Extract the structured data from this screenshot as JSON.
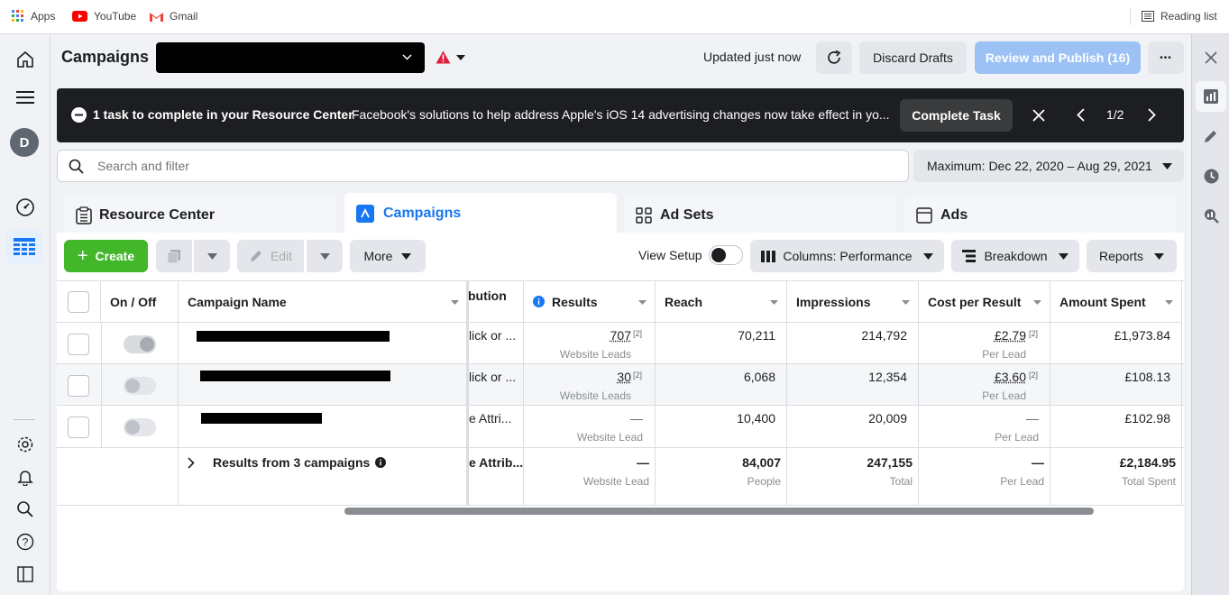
{
  "bookmarks": {
    "apps": "Apps",
    "youtube": "YouTube",
    "gmail": "Gmail",
    "reading_list": "Reading list"
  },
  "header": {
    "title": "Campaigns",
    "updated": "Updated just now",
    "discard": "Discard Drafts",
    "publish": "Review and Publish (16)",
    "more_dots": "•••"
  },
  "banner": {
    "task": "1 task to complete in your Resource Center",
    "message": "Facebook's solutions to help address Apple's iOS 14 advertising changes now take effect in yo...",
    "button": "Complete Task",
    "pager": "1/2"
  },
  "search": {
    "placeholder": "Search and filter"
  },
  "daterange": {
    "label": "Maximum: Dec 22, 2020 – Aug 29, 2021"
  },
  "tabs": [
    {
      "label": "Resource Center"
    },
    {
      "label": "Campaigns"
    },
    {
      "label": "Ad Sets"
    },
    {
      "label": "Ads"
    }
  ],
  "toolbar": {
    "create": "Create",
    "edit": "Edit",
    "more": "More",
    "view_setup": "View Setup",
    "columns": "Columns: Performance",
    "breakdown": "Breakdown",
    "reports": "Reports"
  },
  "table": {
    "headers": {
      "onoff": "On / Off",
      "name": "Campaign Name",
      "attribution": "bution",
      "results": "Results",
      "reach": "Reach",
      "impressions": "Impressions",
      "cpr": "Cost per Result",
      "spent": "Amount Spent"
    },
    "rows": [
      {
        "attribution": "lick or ...",
        "results": "707",
        "results_sup": "[2]",
        "results_sub": "Website Leads",
        "reach": "70,211",
        "impressions": "214,792",
        "cpr": "£2.79",
        "cpr_sup": "[2]",
        "cpr_sub": "Per Lead",
        "spent": "£1,973.84",
        "on": true
      },
      {
        "attribution": "lick or ...",
        "results": "30",
        "results_sup": "[2]",
        "results_sub": "Website Leads",
        "reach": "6,068",
        "impressions": "12,354",
        "cpr": "£3.60",
        "cpr_sup": "[2]",
        "cpr_sub": "Per Lead",
        "spent": "£108.13",
        "on": false
      },
      {
        "attribution": "e Attri...",
        "results": "—",
        "results_sup": "",
        "results_sub": "Website Lead",
        "reach": "10,400",
        "impressions": "20,009",
        "cpr": "—",
        "cpr_sup": "",
        "cpr_sub": "Per Lead",
        "spent": "£102.98",
        "on": false
      }
    ],
    "summary": {
      "label": "Results from 3 campaigns",
      "attribution": "e Attrib...",
      "results": "—",
      "results_sub": "Website Lead",
      "reach": "84,007",
      "reach_sub": "People",
      "impressions": "247,155",
      "impressions_sub": "Total",
      "cpr": "—",
      "cpr_sub": "Per Lead",
      "spent": "£2,184.95",
      "spent_sub": "Total Spent"
    }
  },
  "avatar": {
    "letter": "D"
  },
  "colors": {
    "accent": "#1877f2",
    "create": "#42b72a",
    "publish": "#9cc2f5",
    "banner": "#1c1e21",
    "alert": "#e41e3f"
  }
}
